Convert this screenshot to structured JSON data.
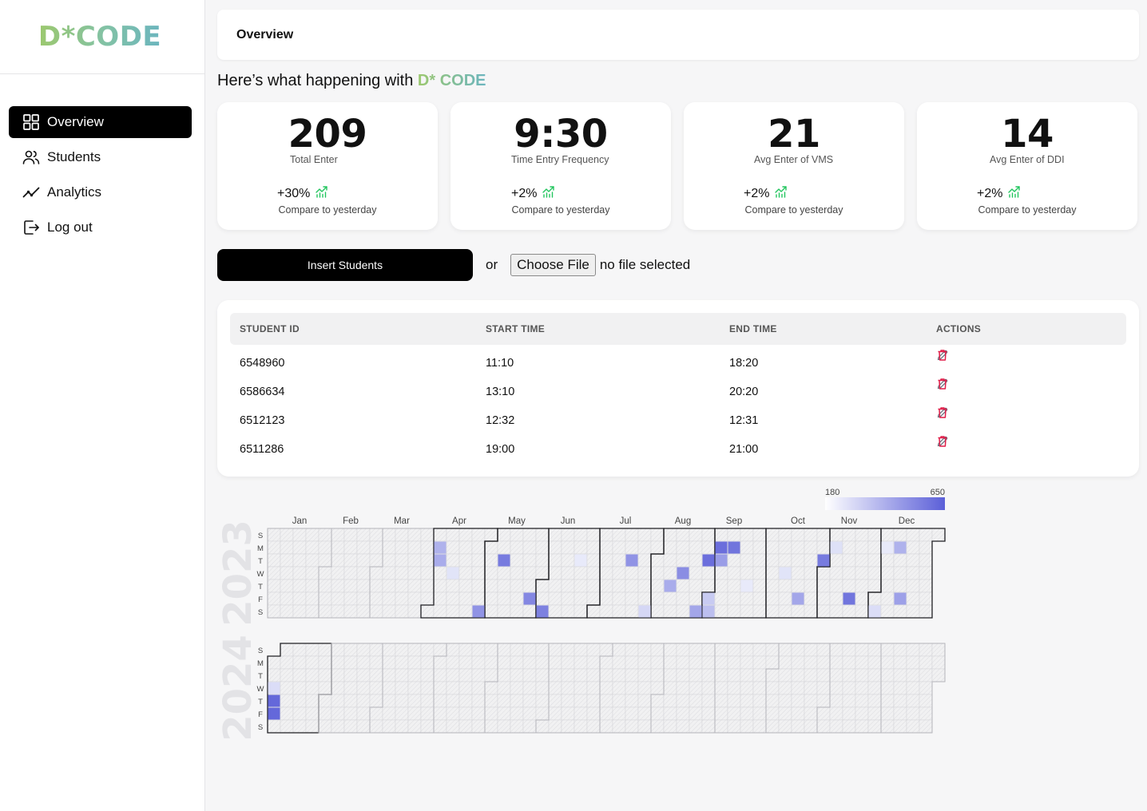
{
  "app": {
    "logo": "D*CODE"
  },
  "sidebar": {
    "items": [
      {
        "label": "Overview",
        "icon": "grid-icon",
        "active": true
      },
      {
        "label": "Students",
        "icon": "users-icon",
        "active": false
      },
      {
        "label": "Analytics",
        "icon": "trend-icon",
        "active": false
      },
      {
        "label": "Log out",
        "icon": "logout-icon",
        "active": false
      }
    ]
  },
  "header": {
    "title": "Overview"
  },
  "greeting": {
    "text": "Here’s what happening with ",
    "brand": "D* CODE"
  },
  "stats": [
    {
      "value": "209",
      "label": "Total Enter",
      "delta": "+30%",
      "compare": "Compare to yesterday"
    },
    {
      "value": "9:30",
      "label": "Time Entry Frequency",
      "delta": "+2%",
      "compare": "Compare to yesterday"
    },
    {
      "value": "21",
      "label": "Avg Enter of VMS",
      "delta": "+2%",
      "compare": "Compare to yesterday"
    },
    {
      "value": "14",
      "label": "Avg Enter of DDI",
      "delta": "+2%",
      "compare": "Compare to yesterday"
    }
  ],
  "insert": {
    "button_label": "Insert Students",
    "or_label": "or",
    "file_button_label": "Choose File",
    "file_status": "no file selected"
  },
  "table": {
    "headers": [
      "STUDENT ID",
      "START TIME",
      "END TIME",
      "ACTIONS"
    ],
    "rows": [
      [
        "6548960",
        "11:10",
        "18:20"
      ],
      [
        "6586634",
        "13:10",
        "20:20"
      ],
      [
        "6512123",
        "12:32",
        "12:31"
      ],
      [
        "6511286",
        "19:00",
        "21:00"
      ]
    ]
  },
  "colors": {
    "accent": "#000000",
    "trend_up": "#22c55e",
    "delete": "#e11d48",
    "edit": "#6b7280",
    "heat_low": "#eef0fb",
    "heat_high": "#5b5fd8"
  },
  "chart_data": {
    "type": "heatmap",
    "legend": {
      "min": "180",
      "max": "650"
    },
    "weekday_labels": [
      "S",
      "M",
      "T",
      "W",
      "T",
      "F",
      "S"
    ],
    "month_labels": [
      "Jan",
      "Feb",
      "Mar",
      "Apr",
      "May",
      "Jun",
      "Jul",
      "Aug",
      "Sep",
      "Oct",
      "Nov",
      "Dec"
    ],
    "years": [
      {
        "year": "2023",
        "cells": [
          {
            "date": "2023-04-03",
            "value": 380
          },
          {
            "date": "2023-04-04",
            "value": 400
          },
          {
            "date": "2023-04-12",
            "value": 220
          },
          {
            "date": "2023-04-29",
            "value": 480
          },
          {
            "date": "2023-05-09",
            "value": 560
          },
          {
            "date": "2023-05-26",
            "value": 520
          },
          {
            "date": "2023-06-03",
            "value": 540
          },
          {
            "date": "2023-06-20",
            "value": 200
          },
          {
            "date": "2023-07-18",
            "value": 480
          },
          {
            "date": "2023-07-29",
            "value": 260
          },
          {
            "date": "2023-08-10",
            "value": 400
          },
          {
            "date": "2023-08-16",
            "value": 500
          },
          {
            "date": "2023-08-26",
            "value": 420
          },
          {
            "date": "2023-08-29",
            "value": 600
          },
          {
            "date": "2023-09-01",
            "value": 300
          },
          {
            "date": "2023-09-02",
            "value": 340
          },
          {
            "date": "2023-09-04",
            "value": 600
          },
          {
            "date": "2023-09-05",
            "value": 450
          },
          {
            "date": "2023-09-11",
            "value": 580
          },
          {
            "date": "2023-09-21",
            "value": 200
          },
          {
            "date": "2023-10-11",
            "value": 220
          },
          {
            "date": "2023-10-20",
            "value": 420
          },
          {
            "date": "2023-10-31",
            "value": 560
          },
          {
            "date": "2023-11-06",
            "value": 230
          },
          {
            "date": "2023-11-17",
            "value": 580
          },
          {
            "date": "2023-12-02",
            "value": 240
          },
          {
            "date": "2023-12-04",
            "value": 200
          },
          {
            "date": "2023-12-11",
            "value": 380
          },
          {
            "date": "2023-12-15",
            "value": 440
          }
        ]
      },
      {
        "year": "2024",
        "cells": [
          {
            "date": "2024-01-03",
            "value": 240
          },
          {
            "date": "2024-01-04",
            "value": 620
          },
          {
            "date": "2024-01-05",
            "value": 620
          }
        ]
      }
    ]
  }
}
